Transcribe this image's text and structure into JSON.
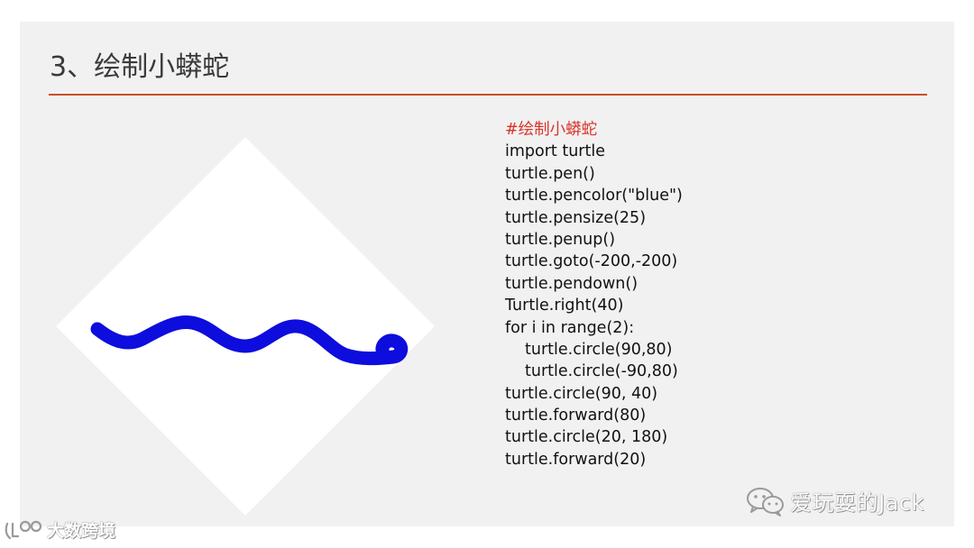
{
  "slide": {
    "title": "3、绘制小蟒蛇"
  },
  "turtle_canvas": {
    "background_color": "#ffffff",
    "snake_color": "#0d0dde"
  },
  "code": {
    "lines": [
      "#绘制小蟒蛇",
      "import turtle",
      "turtle.pen()",
      "turtle.pencolor(\"blue\")",
      "turtle.pensize(25)",
      "turtle.penup()",
      "turtle.goto(-200,-200)",
      "turtle.pendown()",
      "Turtle.right(40)",
      "for i in range(2):",
      "turtle.circle(90,80)",
      "turtle.circle(-90,80)",
      "turtle.circle(90, 40)",
      "turtle.forward(80)",
      "turtle.circle(20, 180)",
      "turtle.forward(20)"
    ]
  },
  "watermarks": {
    "wechat_account": "爱玩耍的Jack",
    "site": "大数跨境"
  },
  "colors": {
    "slide_background": "#f1f1f1",
    "title_rule": "#c9502a",
    "comment": "#d9342b",
    "code_text": "#111111"
  }
}
